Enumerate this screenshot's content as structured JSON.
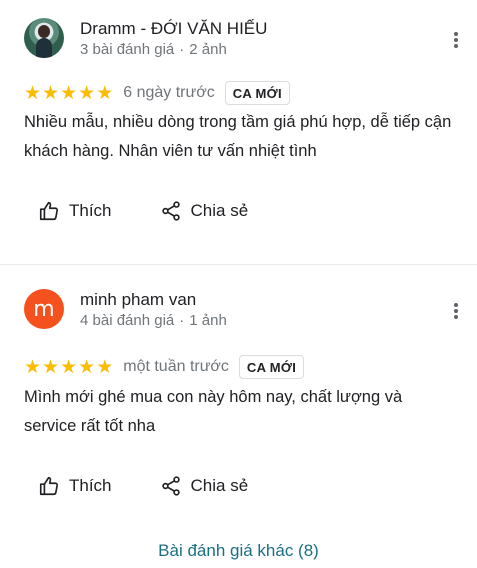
{
  "reviews": [
    {
      "author": "Dramm - ĐỚI VĂN HIẾU",
      "review_count": "3 bài đánh giá",
      "photo_count": "2 ảnh",
      "avatar_letter": "",
      "rating": 5,
      "stars": "★★★★★",
      "time": "6 ngày trước",
      "badge": "CA MỚI",
      "text": "Nhiều mẫu, nhiều dòng trong tầm giá phú hợp, dễ tiếp cận khách hàng. Nhân viên tư vấn nhiệt tình",
      "like_label": "Thích",
      "share_label": "Chia sẻ"
    },
    {
      "author": "minh pham van",
      "review_count": "4 bài đánh giá",
      "photo_count": "1 ảnh",
      "avatar_letter": "m",
      "rating": 5,
      "stars": "★★★★★",
      "time": "một tuần trước",
      "badge": "CA MỚI",
      "text": "Mình mới ghé mua con này hôm nay, chất lượng và service rất tốt nha",
      "like_label": "Thích",
      "share_label": "Chia sẻ"
    }
  ],
  "more_reviews_label": "Bài đánh giá khác (8)",
  "icons": {
    "more": "more-vert-icon",
    "like": "thumb-up-icon",
    "share": "share-icon",
    "star": "star-icon"
  },
  "colors": {
    "star": "#fbbc04",
    "avatar_letter_bg": "#f4511e",
    "link": "#1a6f83"
  }
}
